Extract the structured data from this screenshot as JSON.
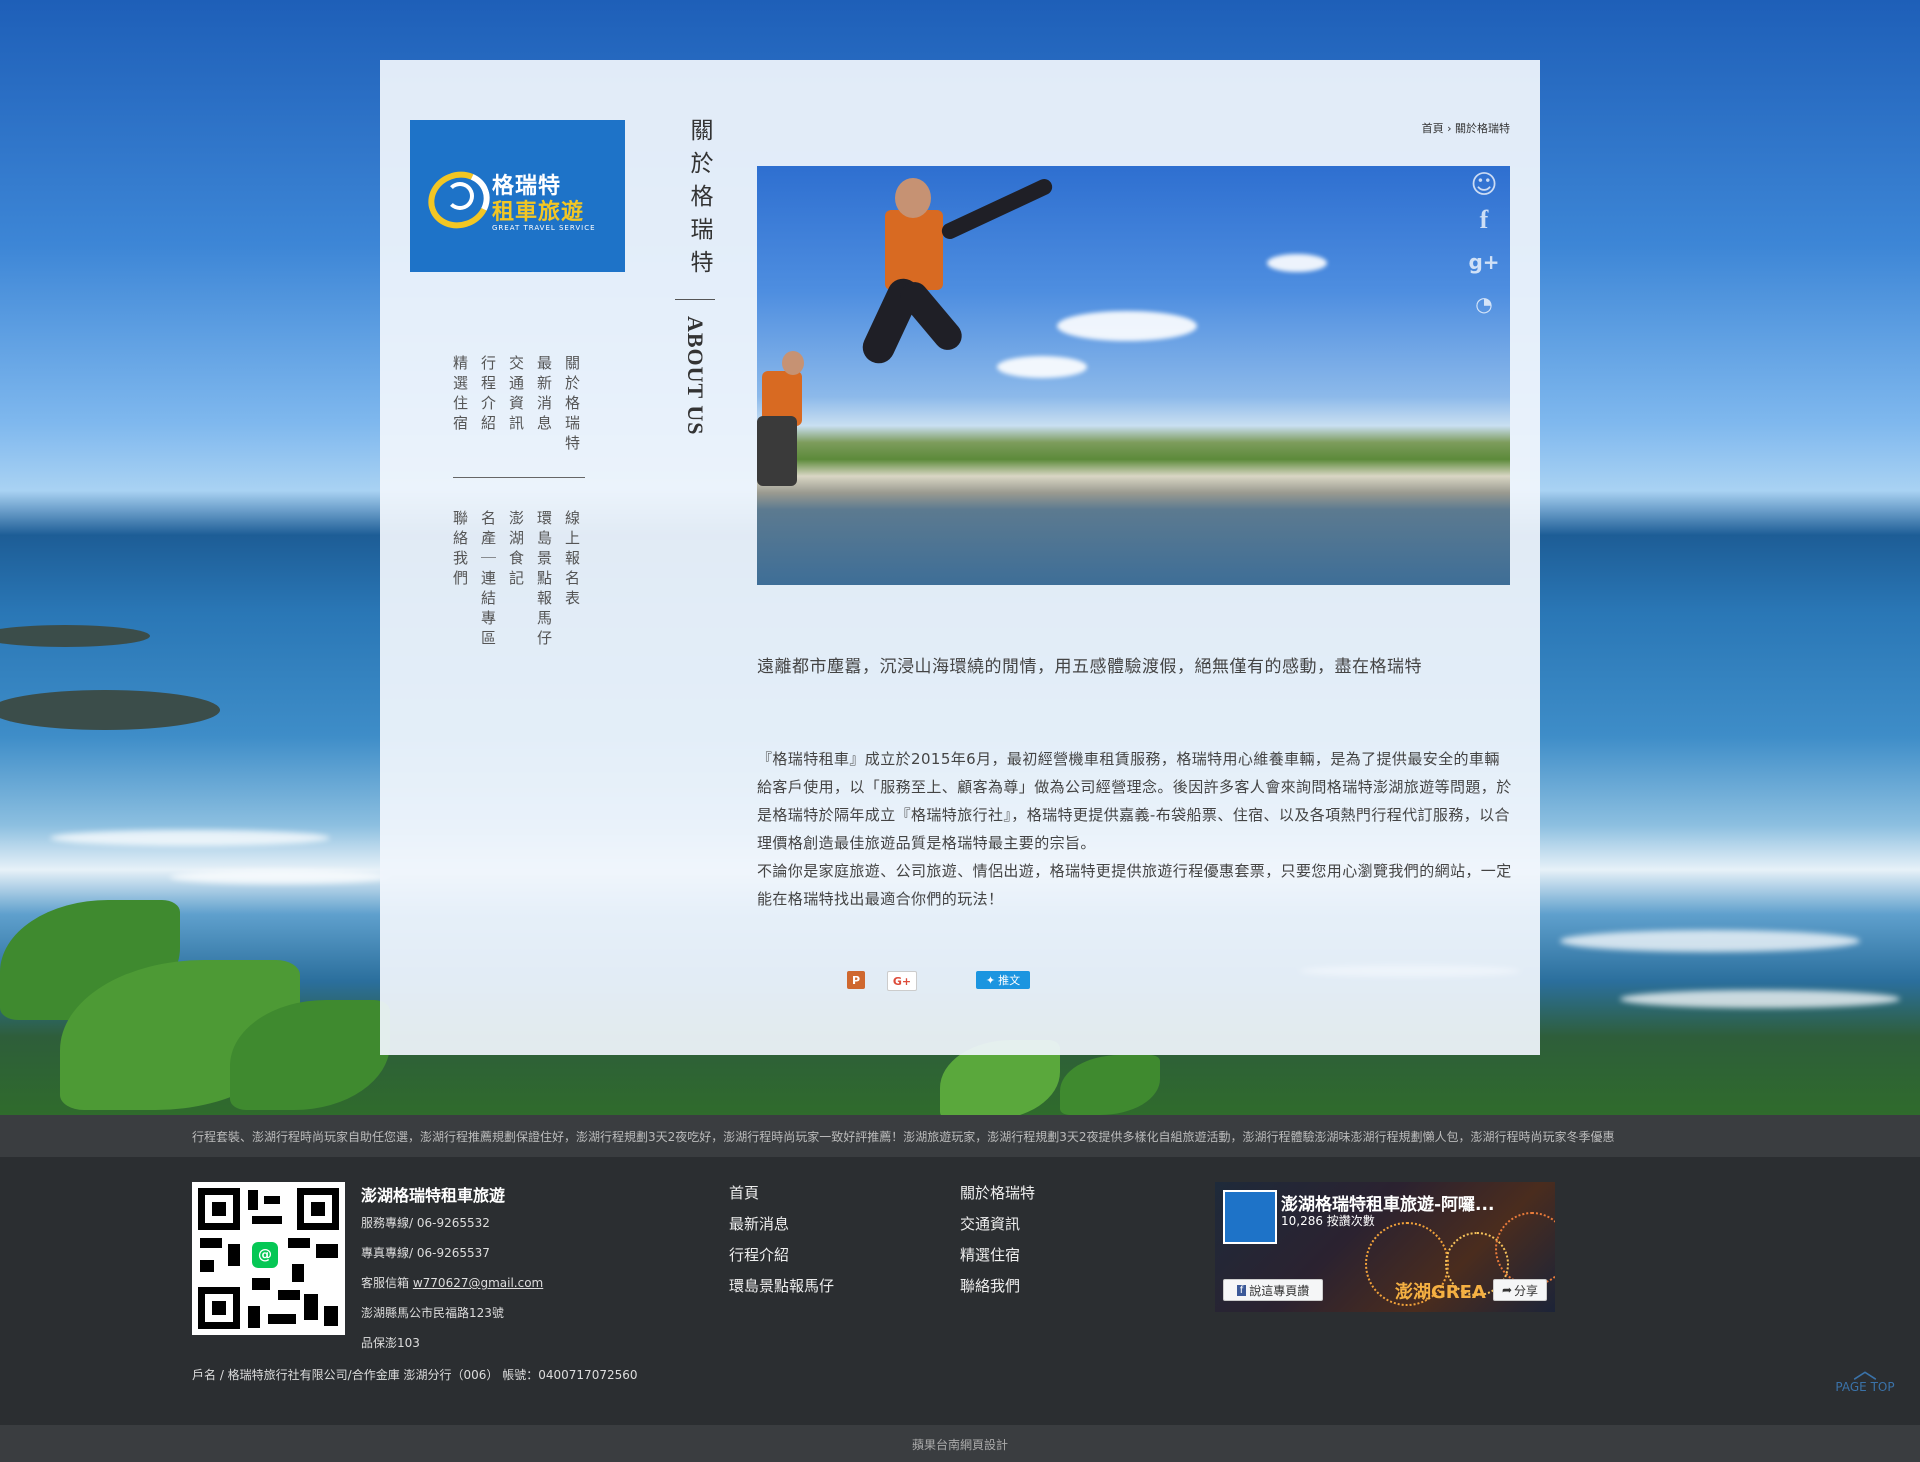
{
  "logo": {
    "name_line1": "格瑞特",
    "name_line2": "租車旅遊",
    "tagline": "GREAT TRAVEL SERVICE"
  },
  "nav": {
    "primary": [
      "關於格瑞特",
      "最新消息",
      "交通資訊",
      "行程介紹",
      "精選住宿"
    ],
    "secondary": [
      "線上報名表",
      "環島景點報馬仔",
      "澎湖食記",
      "名產｜連結專區",
      "聯絡我們"
    ]
  },
  "page": {
    "title_cn": "關於格瑞特",
    "title_en": "ABOUT US"
  },
  "breadcrumb": {
    "home": "首頁",
    "sep": "›",
    "current": "關於格瑞特"
  },
  "social_icons": [
    "plurk-icon",
    "facebook-icon",
    "google-plus-icon",
    "rss-icon"
  ],
  "content": {
    "lead": "遠離都市塵囂，沉浸山海環繞的閒情，用五感體驗渡假，絕無僅有的感動，盡在格瑞特",
    "paragraphs": [
      "『格瑞特租車』成立於2015年6月，最初經營機車租賃服務，格瑞特用心維養車輛，是為了提供最安全的車輛給客戶使用，以「服務至上、顧客為尊」做為公司經營理念。後因許多客人會來詢問格瑞特澎湖旅遊等問題，於是格瑞特於隔年成立『格瑞特旅行社』，格瑞特更提供嘉義-布袋船票、住宿、以及各項熱門行程代訂服務，以合理價格創造最佳旅遊品質是格瑞特最主要的宗旨。",
      "不論你是家庭旅遊、公司旅遊、情侶出遊，格瑞特更提供旅遊行程優惠套票，只要您用心瀏覽我們的網站，一定能在格瑞特找出最適合你們的玩法！"
    ]
  },
  "share": {
    "plurk": "P",
    "gplus": "G+",
    "tweet": "推文"
  },
  "ticker": "行程套裝、澎湖行程時尚玩家自助任您選，澎湖行程推薦規劃保證住好，澎湖行程規劃3天2夜吃好，澎湖行程時尚玩家一致好評推薦！澎湖旅遊玩家，澎湖行程規劃3天2夜提供多樣化自組旅遊活動，澎湖行程體驗澎湖味澎湖行程規劃懶人包，澎湖行程時尚玩家冬季優惠",
  "footer": {
    "company": "澎湖格瑞特租車旅遊",
    "service_phone": "服務專線/ 06-9265532",
    "fax": "專真專線/ 06-9265537",
    "email_label": "客服信箱",
    "email": "w770627@gmail.com",
    "address": "澎湖縣馬公市民福路123號",
    "license": "品保澎103",
    "bank": "戶名 / 格瑞特旅行社有限公司/合作金庫 澎湖分行（006） 帳號：0400717072560",
    "nav_col1": [
      "首頁",
      "最新消息",
      "行程介紹",
      "環島景點報馬仔"
    ],
    "nav_col2": [
      "關於格瑞特",
      "交通資訊",
      "精選住宿",
      "聯絡我們"
    ]
  },
  "facebook": {
    "page_name": "澎湖格瑞特租車旅遊-阿囉...",
    "likes": "10,286 按讚次數",
    "like_button": "說這專頁讚",
    "share_button": "分享",
    "banner_text": "澎湖GREA"
  },
  "pagetop": "PAGE TOP",
  "credit": "蘋果台南網頁設計"
}
